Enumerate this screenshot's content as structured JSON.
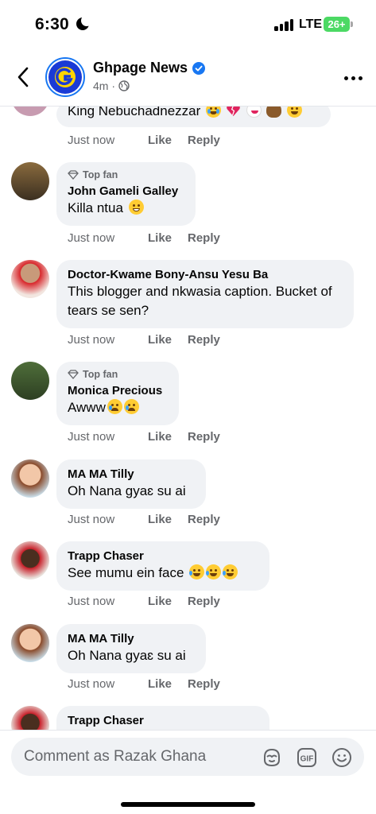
{
  "status_bar": {
    "time": "6:30",
    "network": "LTE",
    "battery": "26+"
  },
  "header": {
    "page_name": "Ghpage News",
    "meta": "4m ·"
  },
  "comments": [
    {
      "author": "",
      "badge": "",
      "text": "King Nebuchadnezzar",
      "time": "Just now",
      "like": "Like",
      "reply": "Reply"
    },
    {
      "author": "John Gameli Galley",
      "badge": "Top fan",
      "text": "Killa ntua",
      "time": "Just now",
      "like": "Like",
      "reply": "Reply"
    },
    {
      "author": "Doctor-Kwame Bony-Ansu Yesu Ba",
      "badge": "",
      "text": "This blogger and nkwasia caption. Bucket of tears se sen?",
      "time": "Just now",
      "like": "Like",
      "reply": "Reply"
    },
    {
      "author": "Monica Precious",
      "badge": "Top fan",
      "text": "Awww",
      "time": "Just now",
      "like": "Like",
      "reply": "Reply"
    },
    {
      "author": "MA MA Tilly",
      "badge": "",
      "text": "Oh Nana gyaɛ su ai",
      "time": "Just now",
      "like": "Like",
      "reply": "Reply"
    },
    {
      "author": "Trapp Chaser",
      "badge": "",
      "text": "See mumu ein face",
      "time": "Just now",
      "like": "Like",
      "reply": "Reply"
    },
    {
      "author": "MA MA Tilly",
      "badge": "",
      "text": "Oh Nana gyaɛ su ai",
      "time": "Just now",
      "like": "Like",
      "reply": "Reply"
    },
    {
      "author": "Trapp Chaser",
      "badge": "",
      "text": "",
      "time": "",
      "like": "",
      "reply": ""
    }
  ],
  "composer": {
    "placeholder": "Comment as Razak Ghana"
  },
  "colors": {
    "accent": "#1877f2",
    "bubble": "#f0f2f5",
    "meta": "#65676b"
  }
}
